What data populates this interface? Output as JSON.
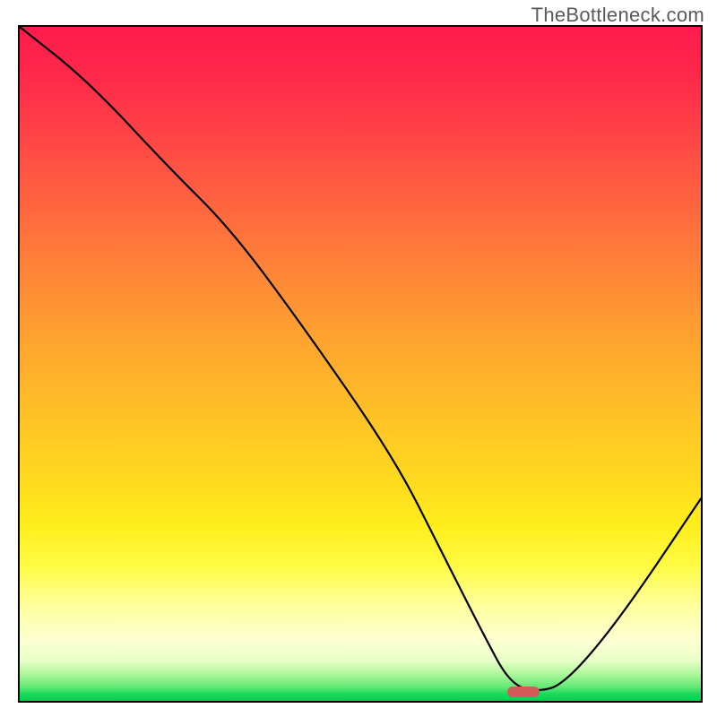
{
  "watermark": "TheBottleneck.com",
  "chart_data": {
    "type": "line",
    "title": "",
    "xlabel": "",
    "ylabel": "",
    "xlim": [
      0,
      100
    ],
    "ylim": [
      0,
      100
    ],
    "line": {
      "name": "bottleneck-curve",
      "x": [
        0,
        10,
        22,
        31,
        42,
        55,
        62,
        68,
        72,
        76,
        80,
        88,
        100
      ],
      "y": [
        100,
        92,
        79,
        70,
        55,
        36,
        22,
        10,
        2.5,
        1.3,
        2.5,
        12,
        30
      ]
    },
    "marker": {
      "x": 74,
      "y": 1.3
    },
    "gradient_stops": [
      {
        "pos": 0,
        "color": "#ff1b4c"
      },
      {
        "pos": 18,
        "color": "#ff4a45"
      },
      {
        "pos": 38,
        "color": "#ff8a36"
      },
      {
        "pos": 58,
        "color": "#ffc226"
      },
      {
        "pos": 74,
        "color": "#ffee1c"
      },
      {
        "pos": 86,
        "color": "#feff9e"
      },
      {
        "pos": 94,
        "color": "#e8ffc7"
      },
      {
        "pos": 100,
        "color": "#00d154"
      }
    ]
  }
}
